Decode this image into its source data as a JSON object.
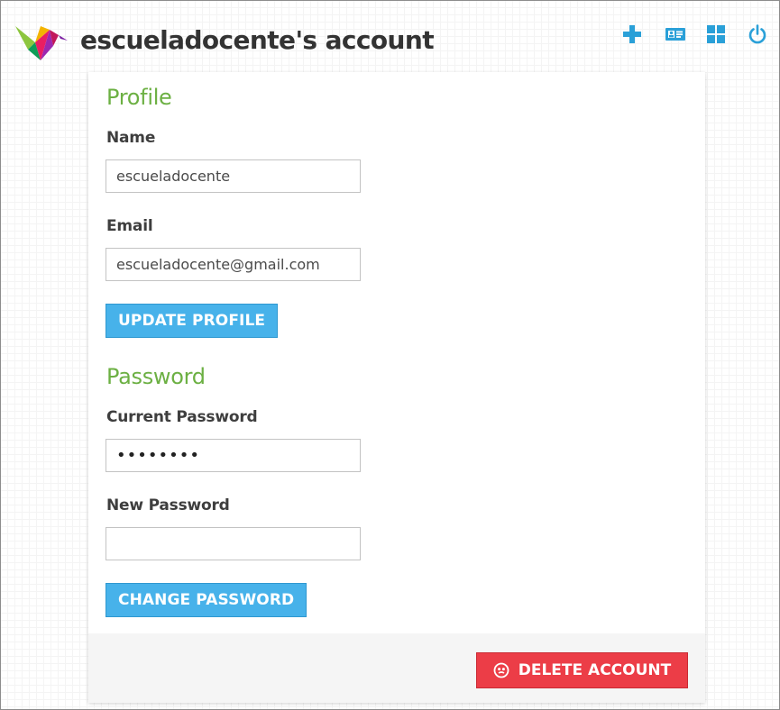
{
  "header": {
    "title": "escueladocente's account",
    "icons": [
      "add-icon",
      "profile-card-icon",
      "dashboard-grid-icon",
      "power-icon"
    ]
  },
  "profile": {
    "heading": "Profile",
    "name_label": "Name",
    "name_value": "escueladocente",
    "email_label": "Email",
    "email_value": "escueladocente@gmail.com",
    "update_button": "UPDATE PROFILE"
  },
  "password": {
    "heading": "Password",
    "current_label": "Current Password",
    "current_value": "12345678",
    "new_label": "New Password",
    "new_value": "",
    "change_button": "CHANGE PASSWORD"
  },
  "footer": {
    "delete_button": "DELETE ACCOUNT"
  },
  "colors": {
    "accent_blue": "#47b2ea",
    "heading_green": "#6cb043",
    "danger_red": "#ec3d47",
    "icon_blue": "#2aa0d8"
  }
}
